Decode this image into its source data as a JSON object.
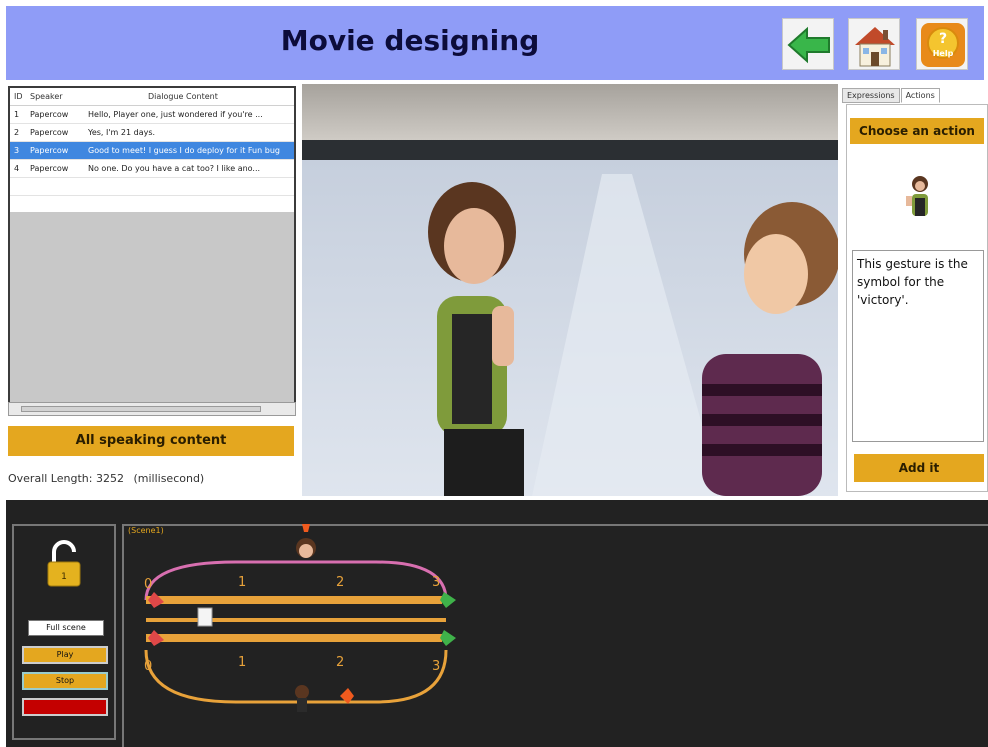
{
  "header": {
    "title": "Movie designing",
    "icons": {
      "back": "back-arrow-icon",
      "home": "home-icon",
      "help": "help-icon"
    },
    "help_label": "Help"
  },
  "dialogue_table": {
    "columns": [
      "ID",
      "Speaker",
      "Dialogue Content"
    ],
    "rows": [
      {
        "id": "1",
        "speaker": "Papercow",
        "content": "Hello, Player one, just wondered if you're ..."
      },
      {
        "id": "2",
        "speaker": "Papercow",
        "content": "Yes, I'm 21 days."
      },
      {
        "id": "3",
        "speaker": "Papercow",
        "content": "Good to meet! I guess I do deploy for it Fun bug"
      },
      {
        "id": "4",
        "speaker": "Papercow",
        "content": "No one. Do you have a cat too? I like ano..."
      }
    ],
    "selected_index": 2
  },
  "left_panel": {
    "all_speaking_label": "All speaking content",
    "overall_length_label": "Overall Length:",
    "overall_length_value": "3252",
    "overall_length_unit": "(millisecond)"
  },
  "right_panel": {
    "tabs": [
      "Expressions",
      "Actions"
    ],
    "active_tab": "Actions",
    "choose_action_label": "Choose an action",
    "gesture_description": "This gesture is the symbol for the 'victory'.",
    "add_label": "Add it"
  },
  "bottom_panel": {
    "lock_icon": "padlock-open-icon",
    "lock_number": "1",
    "play_all_label": "Full scene",
    "play_label": "Play",
    "stop_label": "Stop",
    "timeline_label": "(Scene1)",
    "ticks": [
      "0",
      "1",
      "2",
      "3"
    ]
  },
  "colors": {
    "header_bg": "#8f9cf7",
    "accent": "#e4a71f",
    "selected_row": "#3f87e0",
    "panel_dark": "#222222",
    "track_pink": "#d86fb0",
    "track_orange": "#e8a23a"
  }
}
